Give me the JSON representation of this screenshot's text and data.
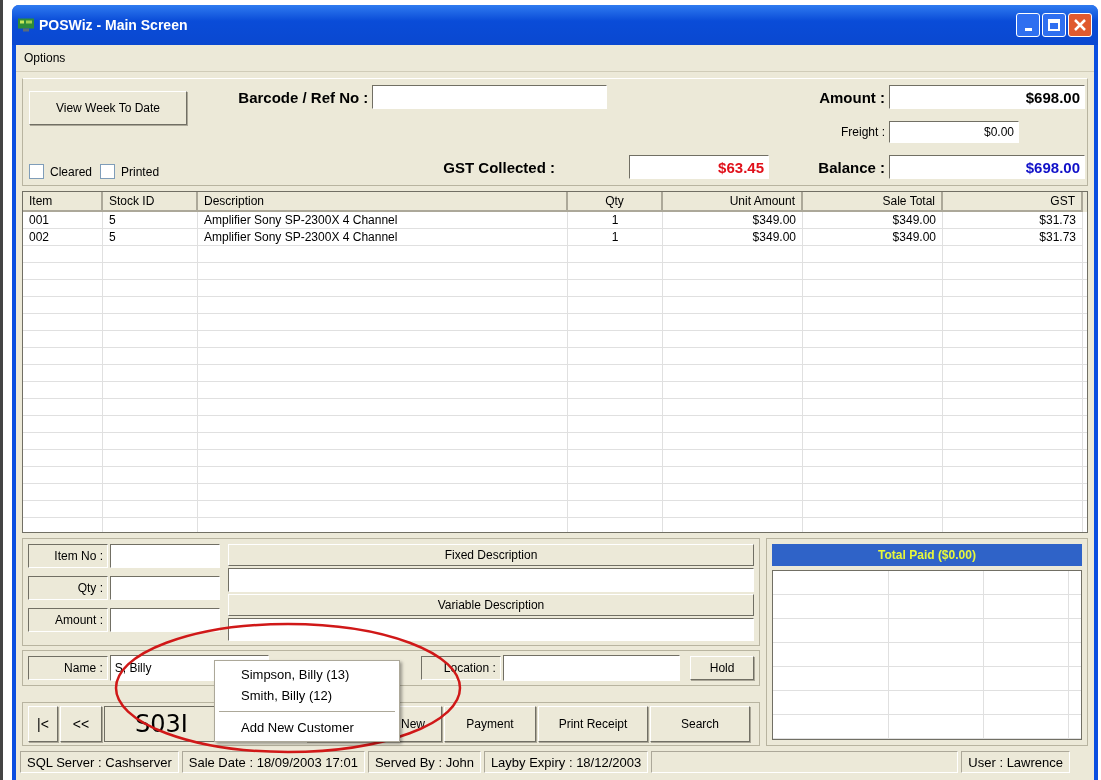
{
  "window": {
    "title": "POSWiz - Main Screen"
  },
  "menu": [
    "Options"
  ],
  "header": {
    "view_button": "View Week To Date",
    "barcode_label": "Barcode / Ref No :",
    "amount_label": "Amount :",
    "amount": "$698.00",
    "freight_label": "Freight :",
    "freight": "$0.00",
    "gst_label": "GST Collected :",
    "gst": "$63.45",
    "balance_label": "Balance :",
    "balance": "$698.00",
    "checkboxes": [
      {
        "label": "Cleared",
        "checked": false
      },
      {
        "label": "Printed",
        "checked": false
      }
    ]
  },
  "table": {
    "columns": [
      "Item",
      "Stock ID",
      "Description",
      "Qty",
      "Unit Amount",
      "Sale Total",
      "GST"
    ],
    "rows": [
      [
        "001",
        "5",
        "Amplifier Sony SP-2300X 4 Channel",
        "1",
        "$349.00",
        "$349.00",
        "$31.73"
      ],
      [
        "002",
        "5",
        "Amplifier Sony SP-2300X 4 Channel",
        "1",
        "$349.00",
        "$349.00",
        "$31.73"
      ]
    ]
  },
  "entry": {
    "item_no_label": "Item No :",
    "qty_label": "Qty :",
    "amount_label": "Amount :",
    "fixed_description": "Fixed Description",
    "variable_description": "Variable Description",
    "name_label": "Name :",
    "name": "S, Billy",
    "location_label": "Location :",
    "hold_button": "Hold"
  },
  "payments": {
    "title": "Total Paid ($0.00)"
  },
  "nav": {
    "first": "|<",
    "prev": "<<",
    "sale_number": "S03I",
    "buttons": [
      "New",
      "Payment",
      "Print Receipt",
      "Search"
    ]
  },
  "customer_menu": {
    "items": [
      {
        "kind": "item",
        "label": "Simpson, Billy (13)"
      },
      {
        "kind": "item",
        "label": "Smith, Billy (12)"
      },
      {
        "kind": "separator"
      },
      {
        "kind": "item",
        "label": "Add New Customer"
      }
    ]
  },
  "status_bar": [
    "SQL Server : Cashserver",
    "Sale Date : 18/09/2003 17:01",
    "Served By : John",
    "Layby Expiry : 18/12/2003",
    "User : Lawrence"
  ]
}
